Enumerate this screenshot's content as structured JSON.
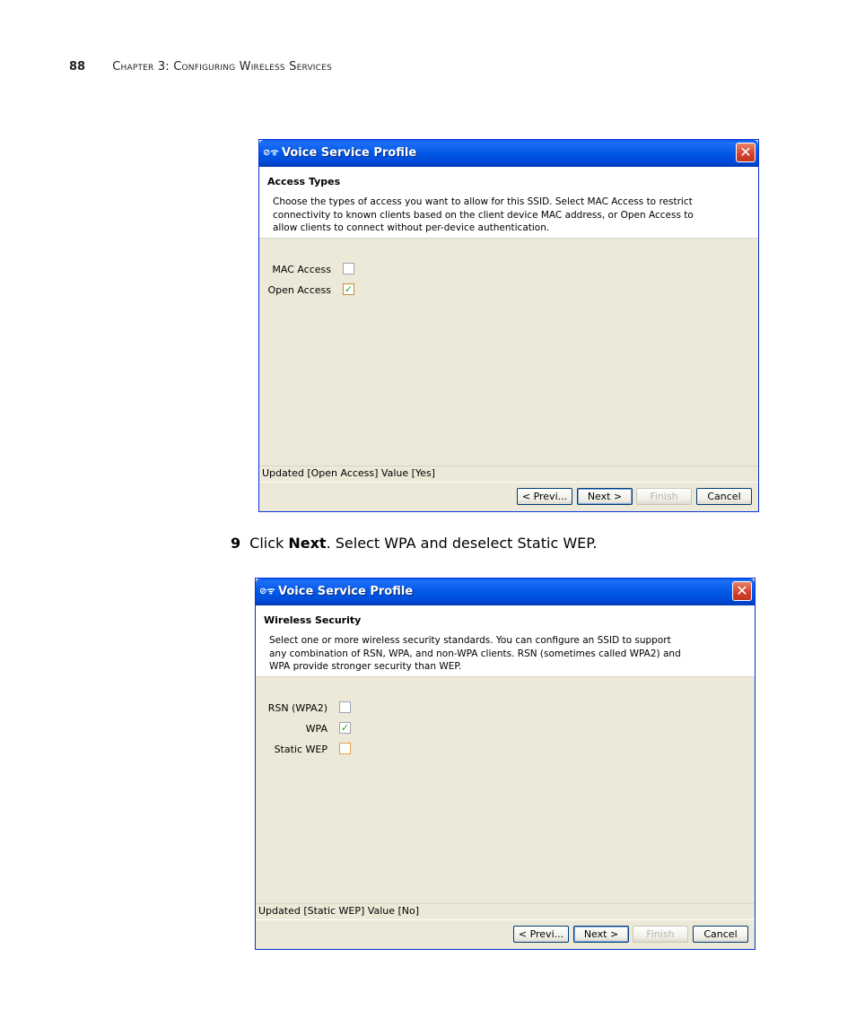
{
  "page": {
    "number": "88",
    "chapter": "Chapter 3: Configuring Wireless Services"
  },
  "step": {
    "number": "9",
    "text_prefix": "Click ",
    "text_bold": "Next",
    "text_suffix": ". Select WPA and deselect Static WEP."
  },
  "dialog1": {
    "title": "Voice Service Profile",
    "icon": "network-icon",
    "header_title": "Access Types",
    "header_description": "Choose the types of access you want to allow for this SSID. Select MAC Access to restrict connectivity to known clients based on the client device MAC address, or Open Access to allow clients to connect without per-device authentication.",
    "options": [
      {
        "label": "MAC Access",
        "checked": false
      },
      {
        "label": "Open Access",
        "checked": true
      }
    ],
    "status": "Updated [Open Access] Value [Yes]",
    "buttons": {
      "prev": "< Previ...",
      "next": "Next >",
      "finish": "Finish",
      "cancel": "Cancel"
    }
  },
  "dialog2": {
    "title": "Voice Service Profile",
    "icon": "network-icon",
    "header_title": "Wireless Security",
    "header_description": "Select one or more wireless security standards. You can configure an SSID to support any combination of RSN, WPA, and non-WPA clients. RSN (sometimes called WPA2) and WPA provide stronger security than WEP.",
    "options": [
      {
        "label": "RSN (WPA2)",
        "checked": false
      },
      {
        "label": "WPA",
        "checked": true
      },
      {
        "label": "Static WEP",
        "checked": false
      }
    ],
    "status": "Updated [Static WEP] Value [No]",
    "buttons": {
      "prev": "< Previ...",
      "next": "Next >",
      "finish": "Finish",
      "cancel": "Cancel"
    }
  },
  "colors": {
    "titlebar": "#0058e6",
    "dialog_bg": "#ece9d8",
    "check_color": "#21a121",
    "close_button": "#d4402a"
  }
}
